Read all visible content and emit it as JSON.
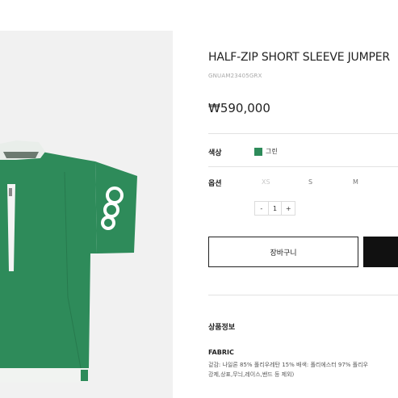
{
  "product": {
    "title": "HALF-ZIP SHORT SLEEVE JUMPER",
    "code": "GNUAM23405GRX",
    "price": "₩590,000",
    "image_alt": "green half-zip short sleeve jumper"
  },
  "options": {
    "color_label": "색상",
    "color_value": "그린",
    "color_hex": "#2e8b5a",
    "size_label": "옵션",
    "sizes": [
      "XS",
      "S",
      "M"
    ],
    "quantity": "1",
    "minus": "-",
    "plus": "+"
  },
  "actions": {
    "cart_label": "장바구니"
  },
  "info": {
    "section_title": "상품정보",
    "fabric_label": "FABRIC",
    "fabric_line1": "겉감: 나일론 85% 폴리우레탄 15% 배색: 폴리에스터 97% 폴리우",
    "fabric_line2": "강제,상표,무늬,레이스,밴드 등 제외)"
  }
}
